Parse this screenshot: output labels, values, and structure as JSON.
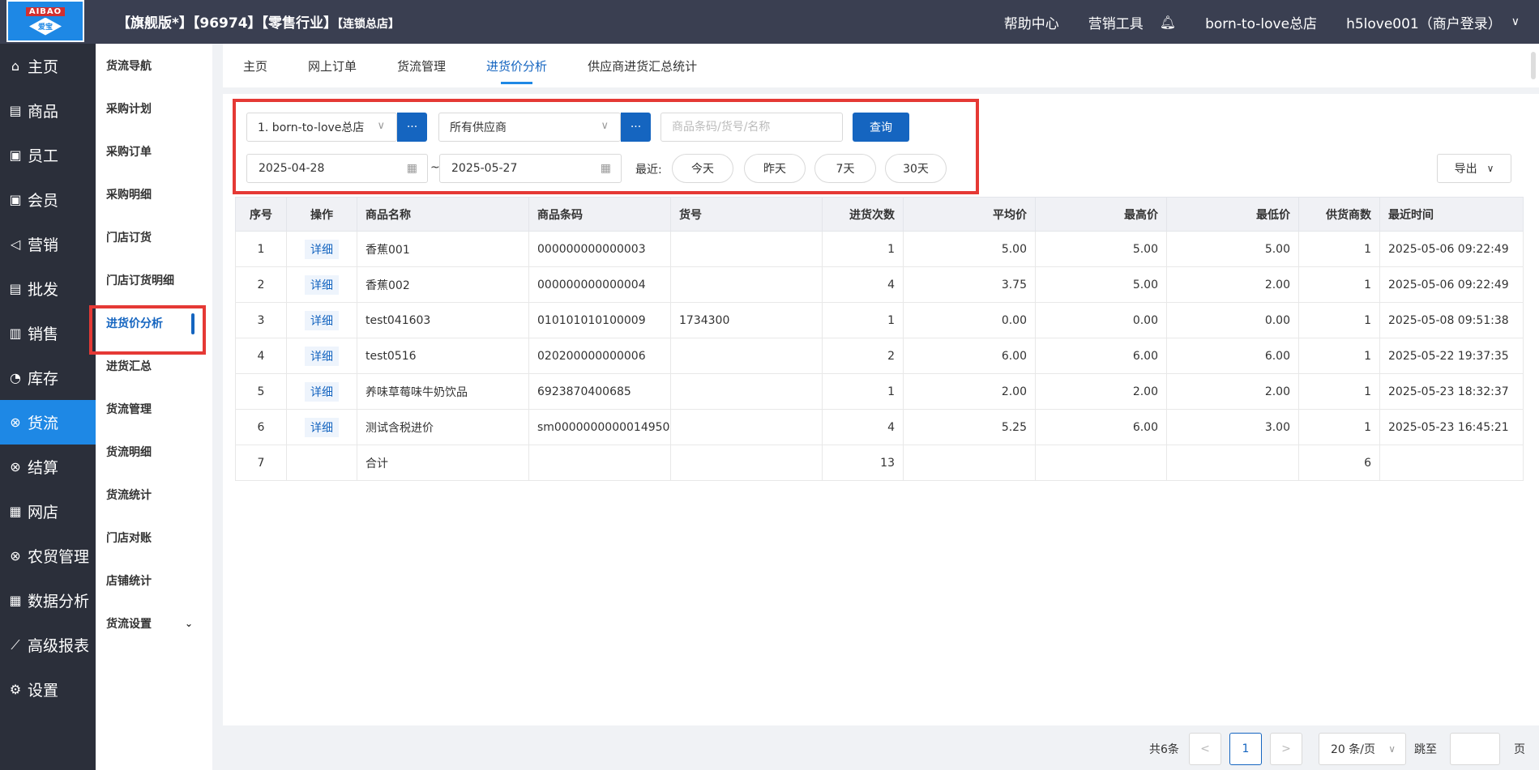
{
  "header": {
    "logo_top": "AIBAO",
    "logo_sub": "爱宝",
    "title_main": "【旗舰版*】【96974】【零售行业】",
    "title_small": "【连锁总店】",
    "help": "帮助中心",
    "marketing_tools": "营销工具",
    "store": "born-to-love总店",
    "user": "h5love001（商户登录）"
  },
  "sidebar": {
    "items": [
      {
        "label": "主页",
        "icon": "⌂"
      },
      {
        "label": "商品",
        "icon": "▤"
      },
      {
        "label": "员工",
        "icon": "▣"
      },
      {
        "label": "会员",
        "icon": "▣"
      },
      {
        "label": "营销",
        "icon": "◁"
      },
      {
        "label": "批发",
        "icon": "▤"
      },
      {
        "label": "销售",
        "icon": "▥"
      },
      {
        "label": "库存",
        "icon": "◔"
      },
      {
        "label": "货流",
        "icon": "⊗"
      },
      {
        "label": "结算",
        "icon": "⊗"
      },
      {
        "label": "网店",
        "icon": "▦"
      },
      {
        "label": "农贸管理",
        "icon": "⊗"
      },
      {
        "label": "数据分析",
        "icon": "▦"
      },
      {
        "label": "高级报表",
        "icon": "⟋"
      },
      {
        "label": "设置",
        "icon": "⚙"
      }
    ]
  },
  "subsidebar": {
    "items": [
      "货流导航",
      "采购计划",
      "采购订单",
      "采购明细",
      "门店订货",
      "门店订货明细",
      "进货价分析",
      "进货汇总",
      "货流管理",
      "货流明细",
      "货流统计",
      "门店对账",
      "店铺统计",
      "货流设置"
    ]
  },
  "tabs": [
    "主页",
    "网上订单",
    "货流管理",
    "进货价分析",
    "供应商进货汇总统计"
  ],
  "filters": {
    "store_select": "1. born-to-love总店",
    "supplier_select": "所有供应商",
    "dots": "···",
    "search_placeholder": "商品条码/货号/名称",
    "query_button": "查询",
    "date_start": "2025-04-28",
    "date_end": "2025-05-27",
    "tilde": "~",
    "recent_label": "最近:",
    "quick": [
      "今天",
      "昨天",
      "7天",
      "30天"
    ],
    "export": "导出"
  },
  "table": {
    "headers": [
      "序号",
      "操作",
      "商品名称",
      "商品条码",
      "货号",
      "进货次数",
      "平均价",
      "最高价",
      "最低价",
      "供货商数",
      "最近时间"
    ],
    "rows": [
      [
        "1",
        "详细",
        "香蕉001",
        "000000000000003",
        "",
        "1",
        "5.00",
        "5.00",
        "5.00",
        "1",
        "2025-05-06 09:22:49"
      ],
      [
        "2",
        "详细",
        "香蕉002",
        "000000000000004",
        "",
        "4",
        "3.75",
        "5.00",
        "2.00",
        "1",
        "2025-05-06 09:22:49"
      ],
      [
        "3",
        "详细",
        "test041603",
        "010101010100009",
        "1734300",
        "1",
        "0.00",
        "0.00",
        "0.00",
        "1",
        "2025-05-08 09:51:38"
      ],
      [
        "4",
        "详细",
        "test0516",
        "020200000000006",
        "",
        "2",
        "6.00",
        "6.00",
        "6.00",
        "1",
        "2025-05-22 19:37:35"
      ],
      [
        "5",
        "详细",
        "养味草莓味牛奶饮品",
        "6923870400685",
        "",
        "1",
        "2.00",
        "2.00",
        "2.00",
        "1",
        "2025-05-23 18:32:37"
      ],
      [
        "6",
        "详细",
        "测试含税进价",
        "sm0000000000014950",
        "",
        "4",
        "5.25",
        "6.00",
        "3.00",
        "1",
        "2025-05-23 16:45:21"
      ],
      [
        "7",
        "",
        "合计",
        "",
        "",
        "13",
        "",
        "",
        "",
        "6",
        ""
      ]
    ]
  },
  "pagination": {
    "total": "共6条",
    "prev": "<",
    "page": "1",
    "next": ">",
    "page_size": "20 条/页",
    "jump_label": "跳至",
    "page_suffix": "页"
  }
}
